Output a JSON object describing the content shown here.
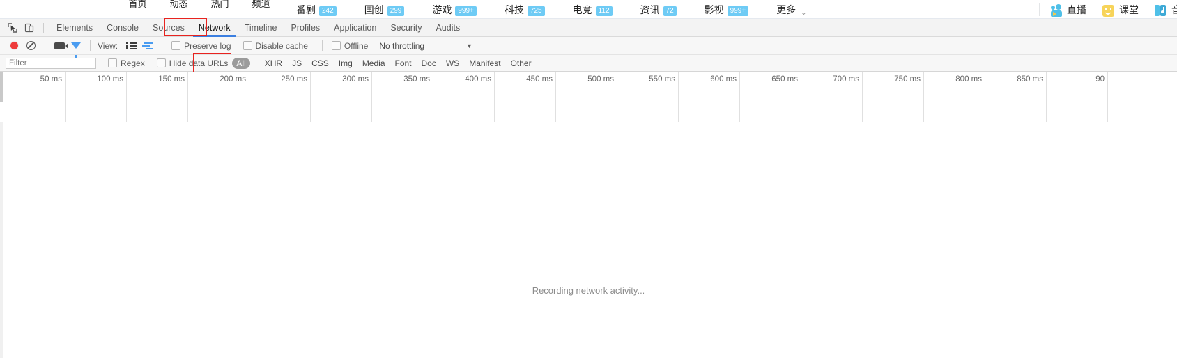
{
  "webpage": {
    "categories": [
      {
        "label": "首页",
        "color": "#fb6f8e"
      },
      {
        "label": "动态",
        "color": "#f9b73f"
      },
      {
        "label": "热门",
        "color": "#f8736d"
      },
      {
        "label": "频道",
        "color": "#63cc77"
      }
    ],
    "nav_links": [
      {
        "label": "番剧",
        "badge": "242"
      },
      {
        "label": "国创",
        "badge": "299"
      },
      {
        "label": "游戏",
        "badge": "999+"
      },
      {
        "label": "科技",
        "badge": "725"
      },
      {
        "label": "电竞",
        "badge": "112"
      },
      {
        "label": "资讯",
        "badge": "72"
      },
      {
        "label": "影视",
        "badge": "999+"
      }
    ],
    "more_label": "更多",
    "right_items": [
      {
        "label": "直播",
        "icon": "live-icon"
      },
      {
        "label": "课堂",
        "icon": "class-icon"
      },
      {
        "label": "音乐",
        "icon": "music-icon"
      }
    ],
    "badge_color": "#6ecbf5"
  },
  "devtools": {
    "tabs": [
      {
        "label": "Elements",
        "active": false
      },
      {
        "label": "Console",
        "active": false
      },
      {
        "label": "Sources",
        "active": false
      },
      {
        "label": "Network",
        "active": true
      },
      {
        "label": "Timeline",
        "active": false
      },
      {
        "label": "Profiles",
        "active": false
      },
      {
        "label": "Application",
        "active": false
      },
      {
        "label": "Security",
        "active": false
      },
      {
        "label": "Audits",
        "active": false
      }
    ],
    "active_tab_underline_color": "#3b7fe0",
    "annotation_color": "#e8231f",
    "toolbar": {
      "record_title": "record-button",
      "clear_title": "clear-button",
      "capture_screenshots_title": "camera-button",
      "filter_title": "funnel-button",
      "view_label": "View:",
      "preserve_log_label": "Preserve log",
      "disable_cache_label": "Disable cache",
      "offline_label": "Offline",
      "throttling_value": "No throttling",
      "throttling_arrow": "▼"
    },
    "filterbar": {
      "filter_placeholder": "Filter",
      "filter_value": "",
      "regex_label": "Regex",
      "hide_data_urls_label": "Hide data URLs",
      "types": [
        {
          "label": "All",
          "active": true
        },
        {
          "label": "XHR",
          "active": false
        },
        {
          "label": "JS",
          "active": false
        },
        {
          "label": "CSS",
          "active": false
        },
        {
          "label": "Img",
          "active": false
        },
        {
          "label": "Media",
          "active": false
        },
        {
          "label": "Font",
          "active": false
        },
        {
          "label": "Doc",
          "active": false
        },
        {
          "label": "WS",
          "active": false
        },
        {
          "label": "Manifest",
          "active": false
        },
        {
          "label": "Other",
          "active": false
        }
      ]
    },
    "overview": {
      "ticks": [
        "50 ms",
        "100 ms",
        "150 ms",
        "200 ms",
        "250 ms",
        "300 ms",
        "350 ms",
        "400 ms",
        "450 ms",
        "500 ms",
        "550 ms",
        "600 ms",
        "650 ms",
        "700 ms",
        "750 ms",
        "800 ms",
        "850 ms",
        "90"
      ],
      "tick_spacing_px": 88
    },
    "empty_state_message": "Recording network activity..."
  }
}
